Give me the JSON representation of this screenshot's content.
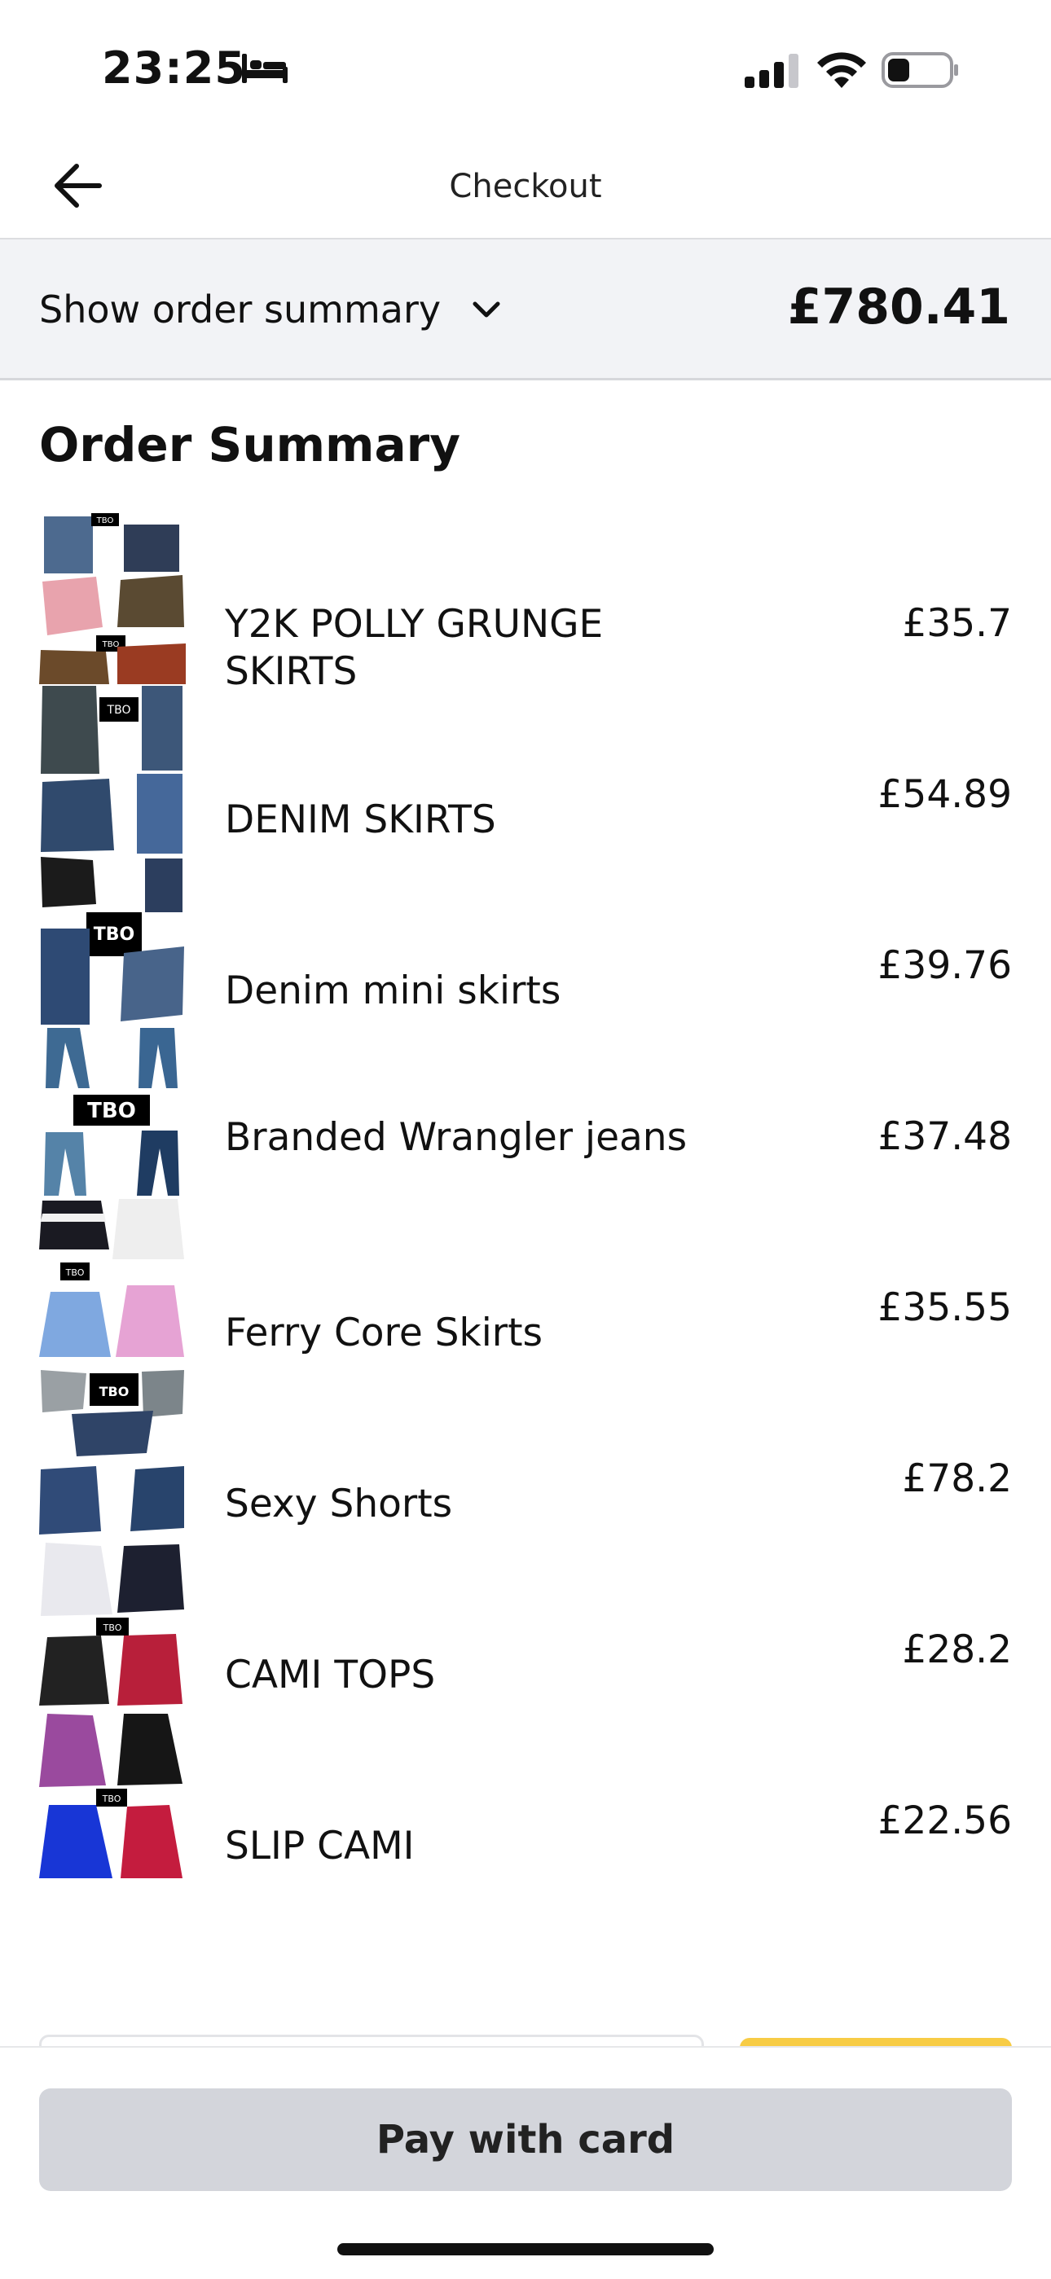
{
  "status": {
    "time": "23:25"
  },
  "nav": {
    "title": "Checkout"
  },
  "summary_bar": {
    "toggle_label": "Show order summary",
    "total": "£780.41"
  },
  "order_summary": {
    "heading": "Order Summary",
    "items": [
      {
        "name": "Y2K POLLY GRUNGE SKIRTS",
        "price": "£35.7"
      },
      {
        "name": "DENIM SKIRTS",
        "price": "£54.89"
      },
      {
        "name": "Denim mini skirts",
        "price": "£39.76"
      },
      {
        "name": "Branded Wrangler jeans",
        "price": "£37.48"
      },
      {
        "name": "Ferry Core Skirts",
        "price": "£35.55"
      },
      {
        "name": "Sexy Shorts",
        "price": "£78.2"
      },
      {
        "name": "CAMI TOPS",
        "price": "£28.2"
      },
      {
        "name": "SLIP CAMI",
        "price": "£22.56"
      }
    ],
    "thumbnail_badge": "TBO"
  },
  "pay_button": {
    "label": "Pay with card"
  },
  "colors": {
    "summary_bg": "#f2f3f6",
    "pay_button_bg": "#d3d5db",
    "accent_yellow": "#f7cc45"
  }
}
